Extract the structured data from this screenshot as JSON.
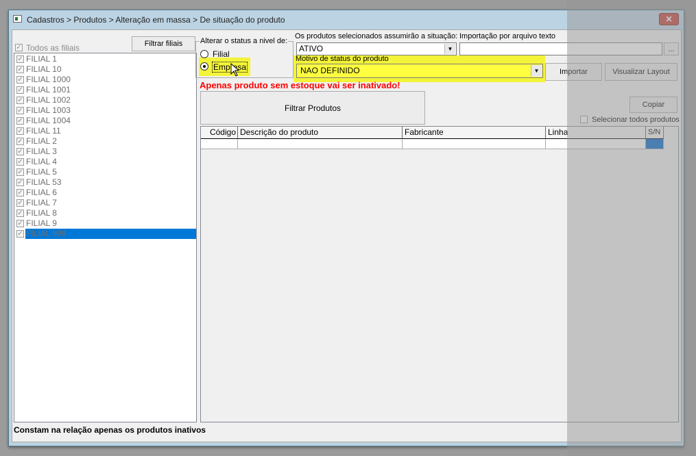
{
  "window": {
    "title": "Cadastros > Produtos > Alteração em massa > De situação do produto",
    "close": "✕"
  },
  "branches": {
    "all_label": "Todos as filiais",
    "filter_button": "Filtrar filiais",
    "items": [
      "FILIAL 1",
      "FILIAL 10",
      "FILIAL 1000",
      "FILIAL 1001",
      "FILIAL 1002",
      "FILIAL 1003",
      "FILIAL 1004",
      "FILIAL 11",
      "FILIAL 2",
      "FILIAL 3",
      "FILIAL 4",
      "FILIAL 5",
      "FILIAL 53",
      "FILIAL 6",
      "FILIAL 7",
      "FILIAL 8",
      "FILIAL 9",
      "FILIAL 999"
    ],
    "selected": "FILIAL 999"
  },
  "level": {
    "legend": "Alterar o status a nivel de:",
    "options": [
      "Filial",
      "Empresa"
    ],
    "selected": "Empresa"
  },
  "situation": {
    "label": "Os produtos selecionados assumirão a situação:",
    "value": "ATIVO"
  },
  "import": {
    "label": "Importação por arquivo texto",
    "value": "",
    "browse": "...",
    "import_button": "Importar",
    "layout_button": "Visualizar Layout"
  },
  "reason": {
    "label": "Motivo de status do produto",
    "value": "NAO DEFINIDO"
  },
  "warning": "Apenas produto sem estoque vai ser inativado!",
  "filter_products": "Filtrar Produtos",
  "copy_button": "Copiar",
  "select_all": "Selecionar todos produtos",
  "grid": {
    "columns": [
      "Código",
      "Descrição do produto",
      "Fabricante",
      "Linha",
      "S/N"
    ]
  },
  "footer": "Constam na relação apenas os produtos inativos",
  "colors": {
    "highlight": "#f3f33a",
    "selection": "#0078d7",
    "warning": "#ff0000"
  }
}
